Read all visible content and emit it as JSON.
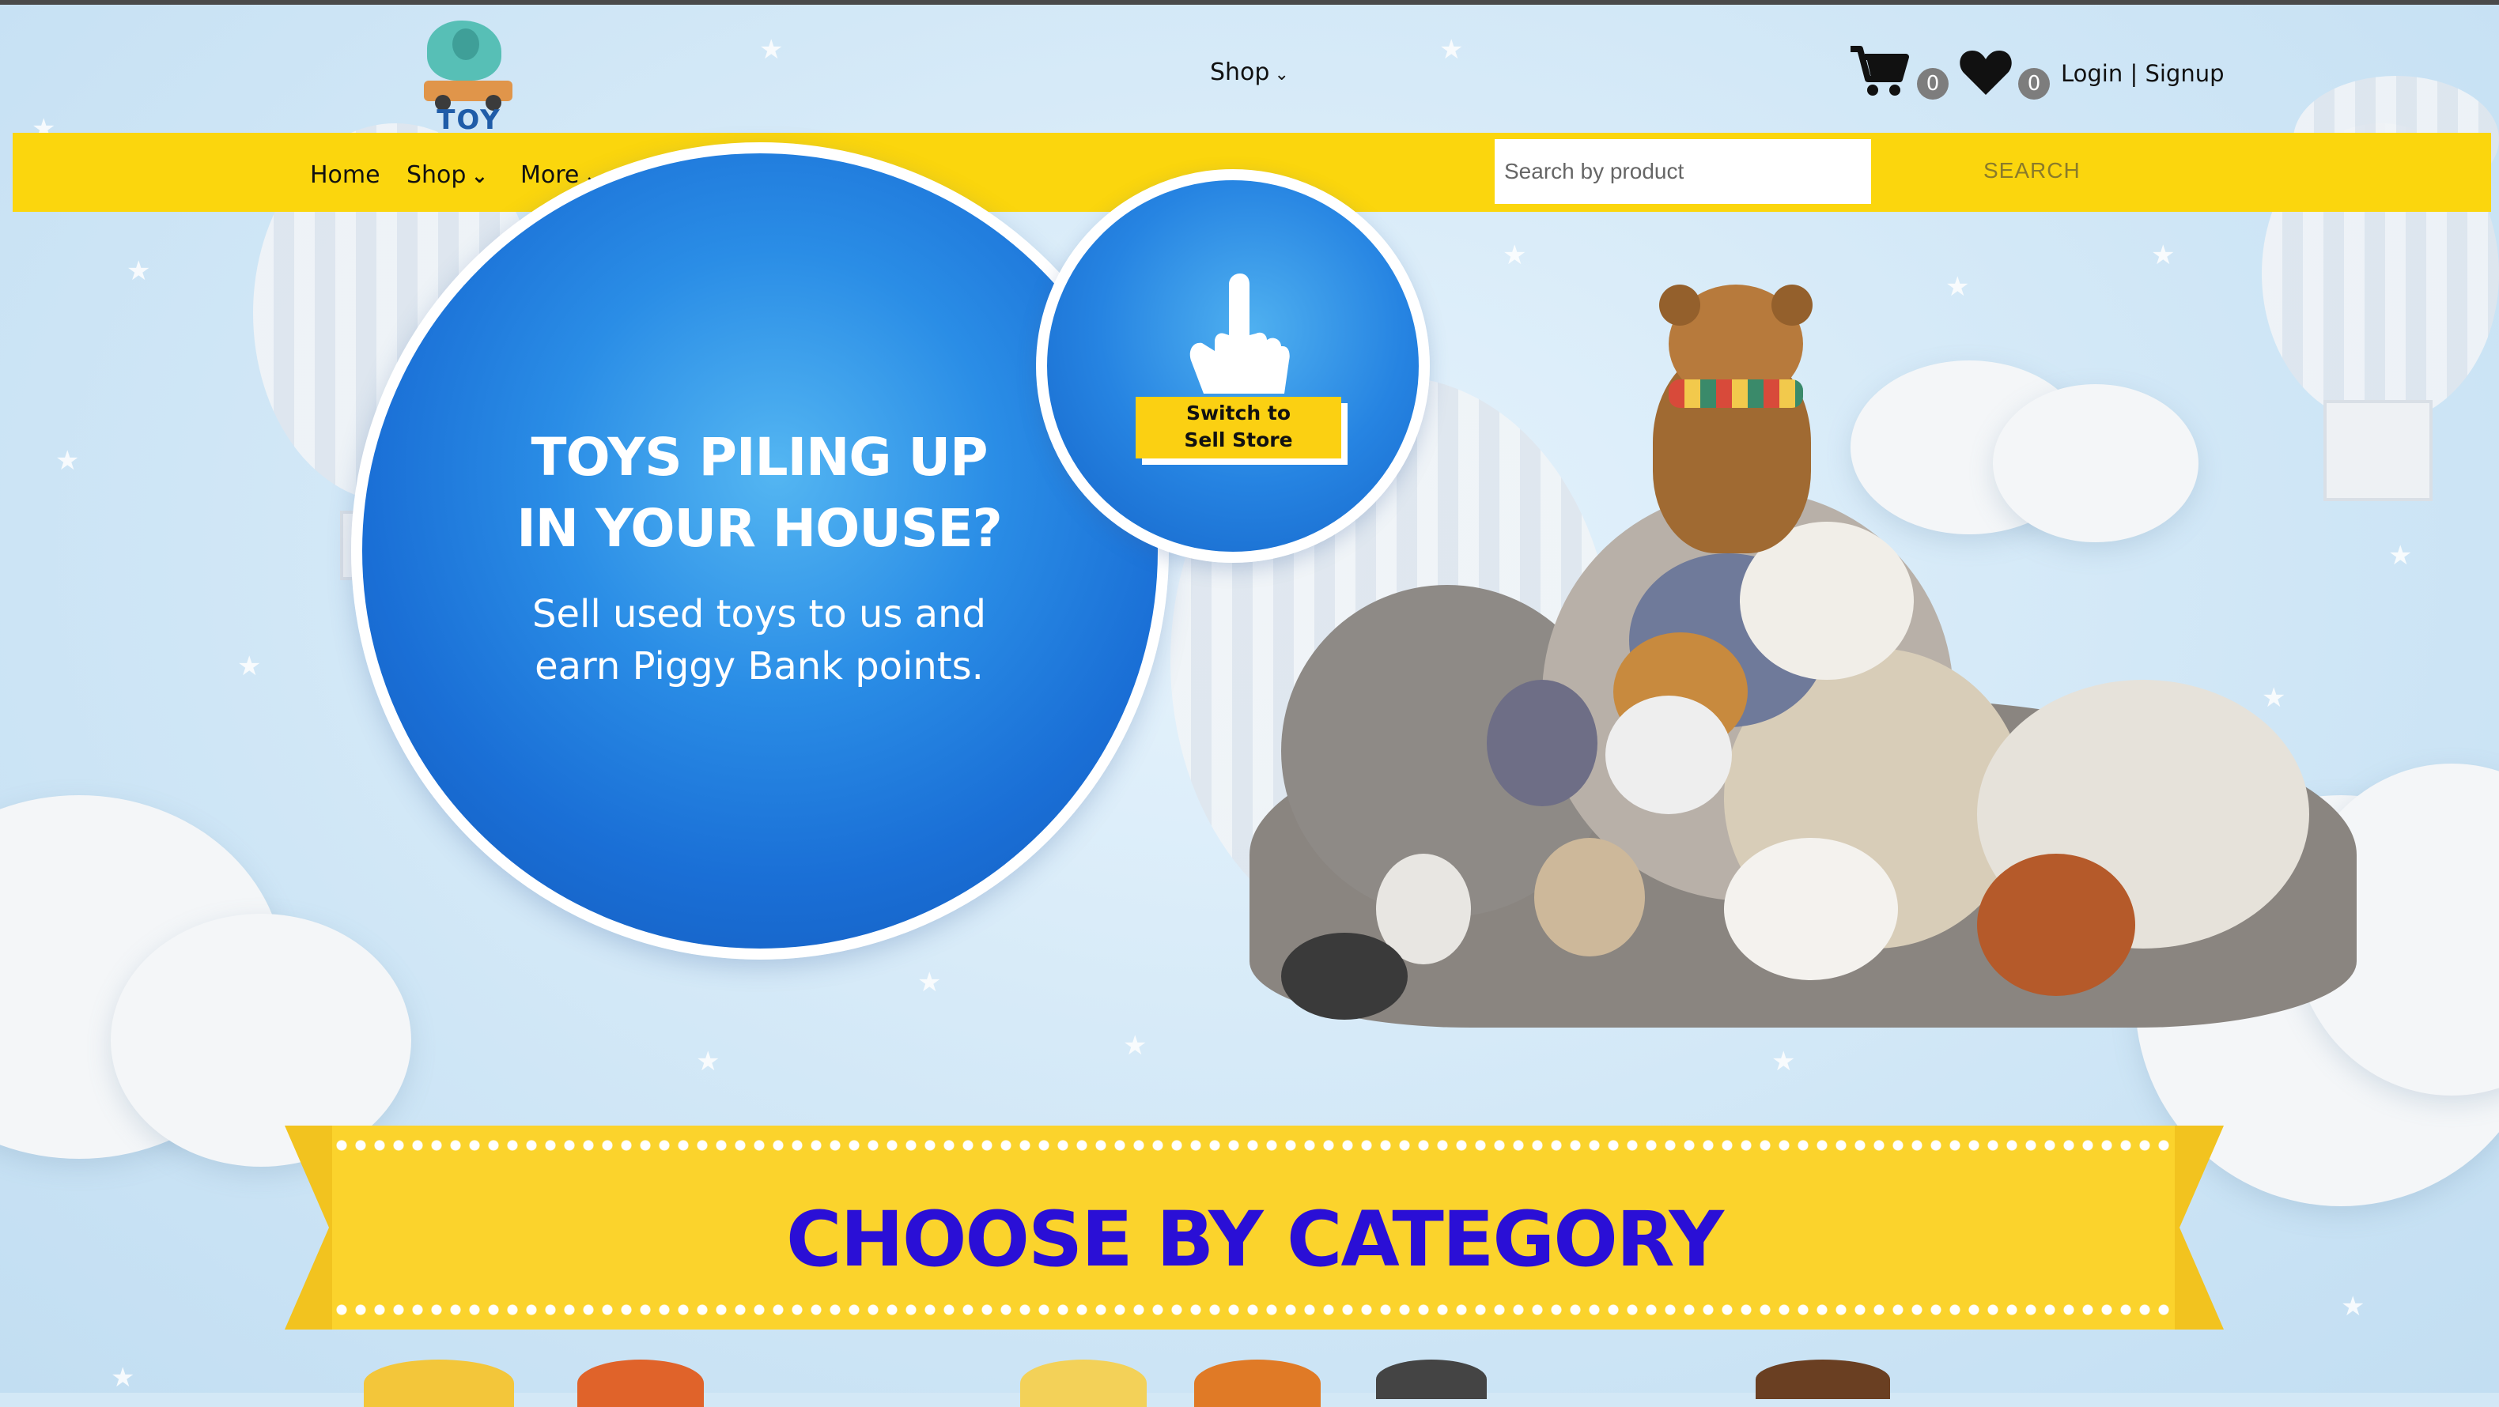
{
  "header": {
    "logo_text": "TOY MARCHE",
    "shop_label": "Shop",
    "cart_count": "0",
    "wishlist_count": "0",
    "auth_label": "Login | Signup"
  },
  "nav": {
    "home": "Home",
    "shop": "Shop",
    "more": "More",
    "search_placeholder": "Search by product",
    "search_button": "SEARCH"
  },
  "hero": {
    "title_line1": "TOYS PILING UP",
    "title_line2": "IN YOUR HOUSE?",
    "subtitle_line1": "Sell used toys to us and",
    "subtitle_line2": "earn Piggy Bank points.",
    "switch_line1": "Switch to",
    "switch_line2": "Sell Store"
  },
  "category": {
    "title": "CHOOSE BY CATEGORY"
  },
  "icons": [
    "cart-icon",
    "heart-icon",
    "chevron-down-icon",
    "pointing-hand-icon"
  ],
  "colors": {
    "nav_yellow": "#fbd60d",
    "hero_blue": "#1a6fd6",
    "category_title": "#2a0fd6",
    "badge_gray": "#7d7d7d"
  }
}
